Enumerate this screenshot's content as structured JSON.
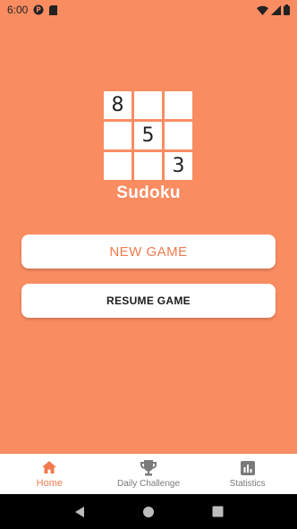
{
  "status_bar": {
    "time": "6:00",
    "icons": [
      "app-notification-icon",
      "sd-card-icon",
      "wifi-icon",
      "signal-icon",
      "battery-icon"
    ]
  },
  "logo": {
    "cells": [
      "8",
      "",
      "",
      "",
      "5",
      "",
      "",
      "",
      "3"
    ]
  },
  "app": {
    "title": "Sudoku"
  },
  "buttons": {
    "new_game": "NEW GAME",
    "resume_game": "RESUME GAME"
  },
  "bottom_nav": {
    "items": [
      {
        "label": "Home",
        "icon": "home-icon",
        "active": true
      },
      {
        "label": "Daily Challenge",
        "icon": "trophy-icon",
        "active": false
      },
      {
        "label": "Statistics",
        "icon": "bar-chart-icon",
        "active": false
      }
    ]
  },
  "system_nav": {
    "icons": [
      "back-icon",
      "home-circle-icon",
      "recents-icon"
    ]
  },
  "colors": {
    "background": "#FA8C62",
    "accent": "#F07A4E",
    "inactive": "#7a7a7a"
  }
}
